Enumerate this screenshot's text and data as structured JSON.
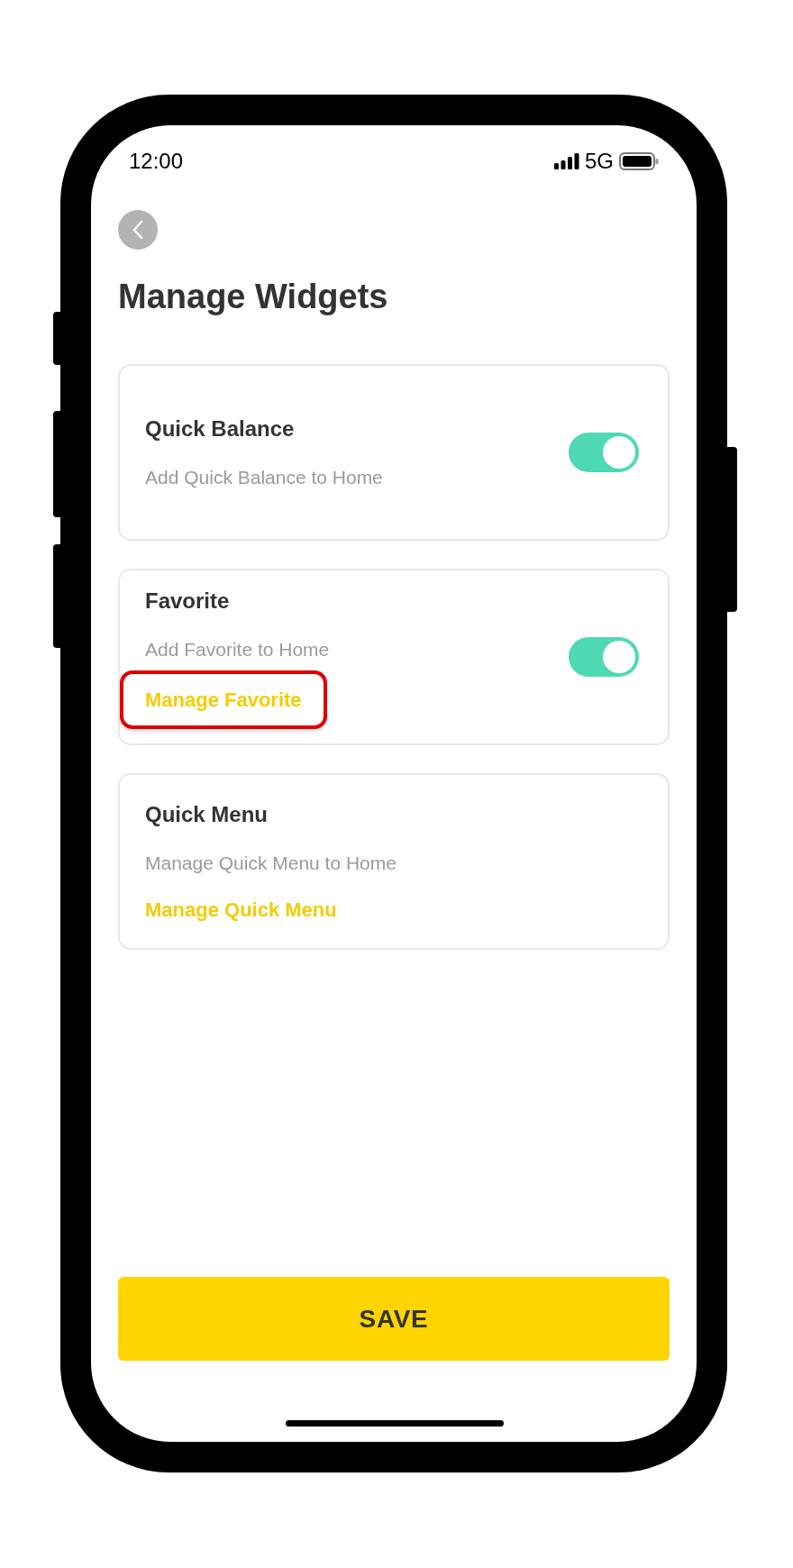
{
  "status_bar": {
    "time": "12:00",
    "network": "5G"
  },
  "header": {
    "title": "Manage Widgets"
  },
  "widgets": [
    {
      "title": "Quick Balance",
      "subtitle": "Add Quick Balance to Home",
      "kind": "toggle",
      "on": true
    },
    {
      "title": "Favorite",
      "subtitle": "Add Favorite to Home",
      "kind": "toggle",
      "on": true,
      "link": "Manage Favorite",
      "link_highlighted": true
    },
    {
      "title": "Quick Menu",
      "subtitle": "Manage Quick Menu to Home",
      "kind": "plain",
      "link": "Manage Quick Menu",
      "link_highlighted": false
    }
  ],
  "save_button": "SAVE"
}
